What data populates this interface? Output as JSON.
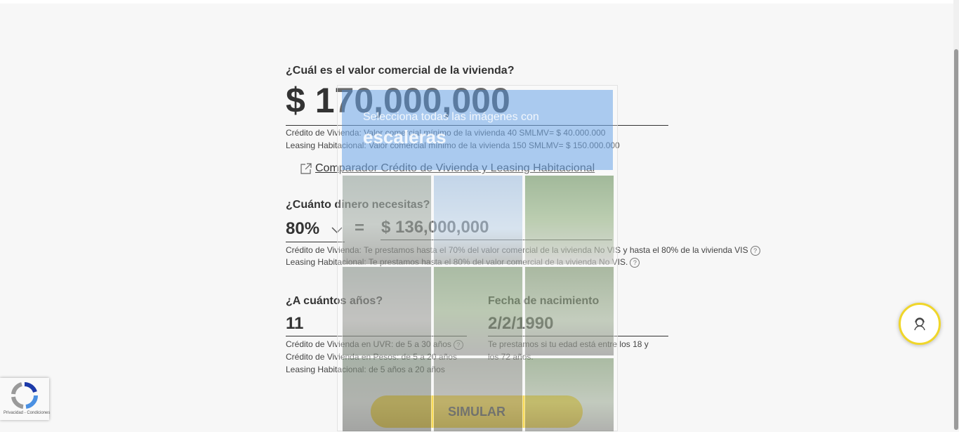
{
  "property_value": {
    "question": "¿Cuál es el valor comercial de la vivienda?",
    "amount": "$ 170,000,000",
    "note_credit": "Crédito de Vivienda: Valor comercial mínimo de la vivienda 40 SMLMV= $ 40.000.000",
    "note_leasing": "Leasing Habitacional: Valor comercial mínimo de la vivienda 150 SMLMV= $ 150.000.000"
  },
  "comparator_link": "Comparador Crédito de Vivienda y Leasing Habitacional",
  "loan": {
    "question": "¿Cuánto dinero necesitas?",
    "percent_selected": "80%",
    "equals": "=",
    "amount": "$ 136,000,000",
    "note_credit": "Crédito de Vivienda: Te prestamos hasta el 70% del valor comercial de la vivienda No VIS y hasta el 80% de la vivienda VIS",
    "note_leasing": "Leasing Habitacional: Te prestamos hasta el 80% del valor comercial de la vivienda No VIS."
  },
  "term": {
    "question": "¿A cuántos años?",
    "value": "11",
    "note_uvr": "Crédito de Vivienda en UVR: de 5 a 30 años",
    "note_pesos": "Crédito de Vivienda en Pesos: de 5 a 20 años",
    "note_leasing": "Leasing Habitacional: de 5 años a 20 años"
  },
  "birthdate": {
    "question": "Fecha de nacimiento",
    "value": "2/2/1990",
    "note_line1": "Te prestamos si tu edad está entre los 18 y",
    "note_line2": "los 72 años."
  },
  "simulate_button": "SIMULAR",
  "help_glyph": "?",
  "captcha": {
    "instruction": "Selecciona todas las imágenes con",
    "target": "escaleras"
  },
  "recaptcha_badge": "Privacidad - Condiciones",
  "colors": {
    "accent": "#f7cd15",
    "text": "#333333",
    "fab_border": "#f0d62a",
    "captcha_blue": "#4a90e2"
  },
  "icons": [
    "external-link-icon",
    "chevron-down-icon",
    "help-circle-icon",
    "agent-headset-icon",
    "recaptcha-logo-icon"
  ]
}
